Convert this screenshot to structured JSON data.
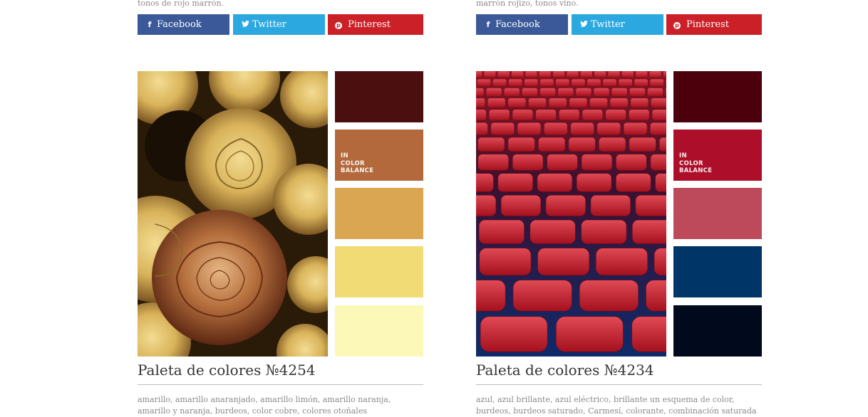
{
  "left": {
    "top_text": "tonos de rojo marrón.",
    "share": {
      "facebook": "Facebook",
      "twitter": "Twitter",
      "pinterest": "Pinterest"
    },
    "swatches": [
      "#4c0f10",
      "#b3693b",
      "#dba652",
      "#f0db74",
      "#fcf8b7"
    ],
    "watermark": [
      "IN",
      "COLOR",
      "BALANCE"
    ],
    "title": "Paleta de colores №4254",
    "tags_line1": "amarillo, amarillo anaranjado, amarillo limón, amarillo naranja,",
    "tags_line2": "amarillo y naranja, burdeos, color cobre, colores otoñales"
  },
  "right": {
    "top_text": "marrón rojizo, tonos vino.",
    "share": {
      "facebook": "Facebook",
      "twitter": "Twitter",
      "pinterest": "Pinterest"
    },
    "swatches": [
      "#4b000b",
      "#ad0f2a",
      "#bd4a5a",
      "#003568",
      "#000a1c"
    ],
    "watermark": [
      "IN",
      "COLOR",
      "BALANCE"
    ],
    "title": "Paleta de colores №4234",
    "tags_line1": "azul, azul brillante, azul eléctrico, brillante un esquema de color,",
    "tags_line2": "burdeos, burdeos saturado, Carmesí, colorante, combinación saturada"
  },
  "colors": {
    "facebook": "#3b5998",
    "twitter": "#2ca8e0",
    "pinterest": "#cb2027"
  }
}
